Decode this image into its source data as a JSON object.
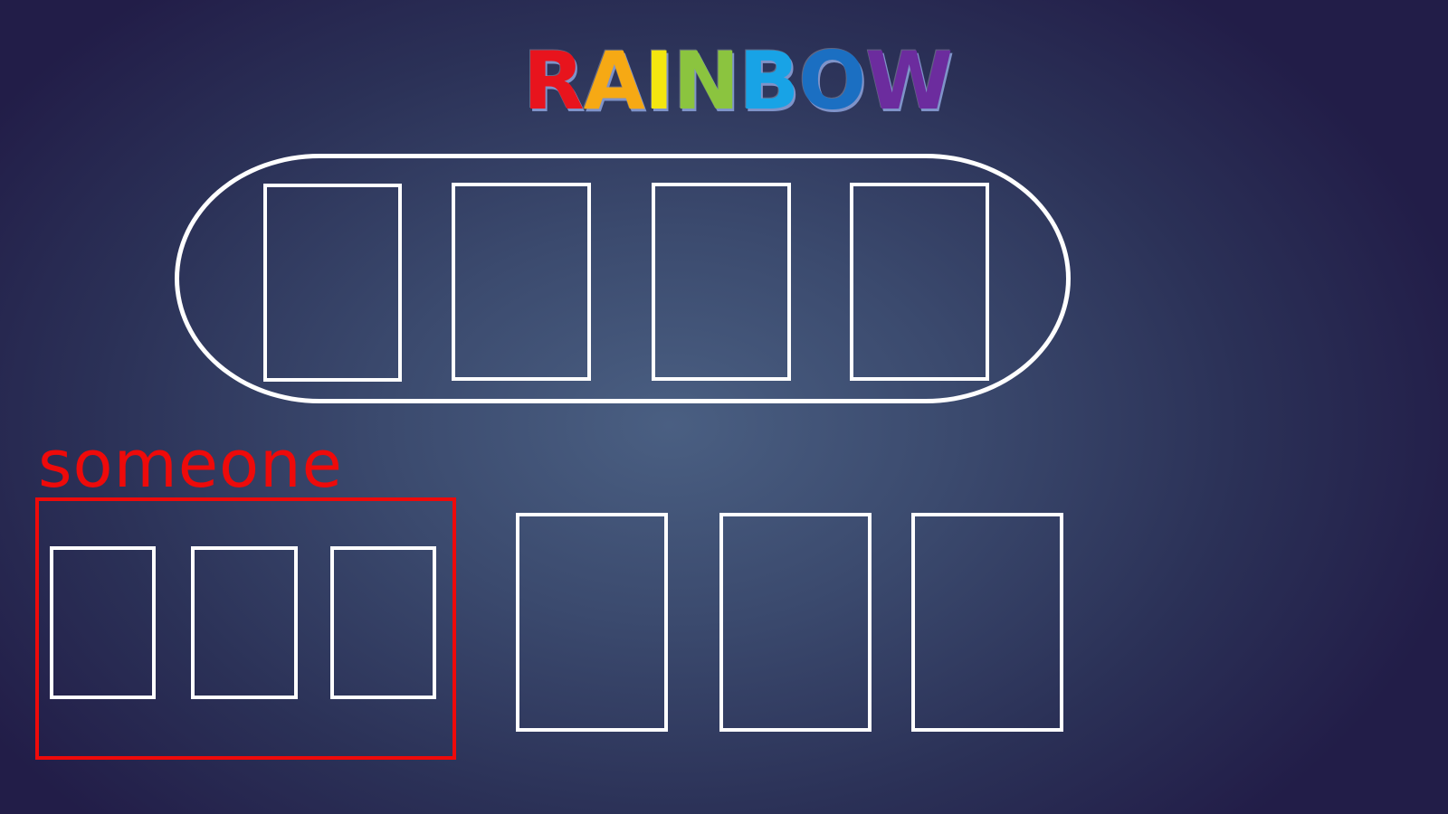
{
  "title": {
    "letters": [
      {
        "char": "R",
        "color": "#e8141d"
      },
      {
        "char": "A",
        "color": "#f6a914"
      },
      {
        "char": "I",
        "color": "#f4e60f"
      },
      {
        "char": "N",
        "color": "#8bc43f"
      },
      {
        "char": "B",
        "color": "#18a3e6"
      },
      {
        "char": "O",
        "color": "#1b6fc2"
      },
      {
        "char": "W",
        "color": "#6c2c9e"
      }
    ]
  },
  "player": {
    "name": "someone",
    "color": "#ee0a0a"
  },
  "colors": {
    "card_outline": "#ffffff",
    "table_outline": "#ffffff",
    "background_center": "#4a5f82",
    "background_edge": "#221d48"
  },
  "board": {
    "shape": "rounded-table",
    "slot_count": 4
  },
  "hand": {
    "card_count": 3
  },
  "deck_piles": {
    "count": 3
  }
}
